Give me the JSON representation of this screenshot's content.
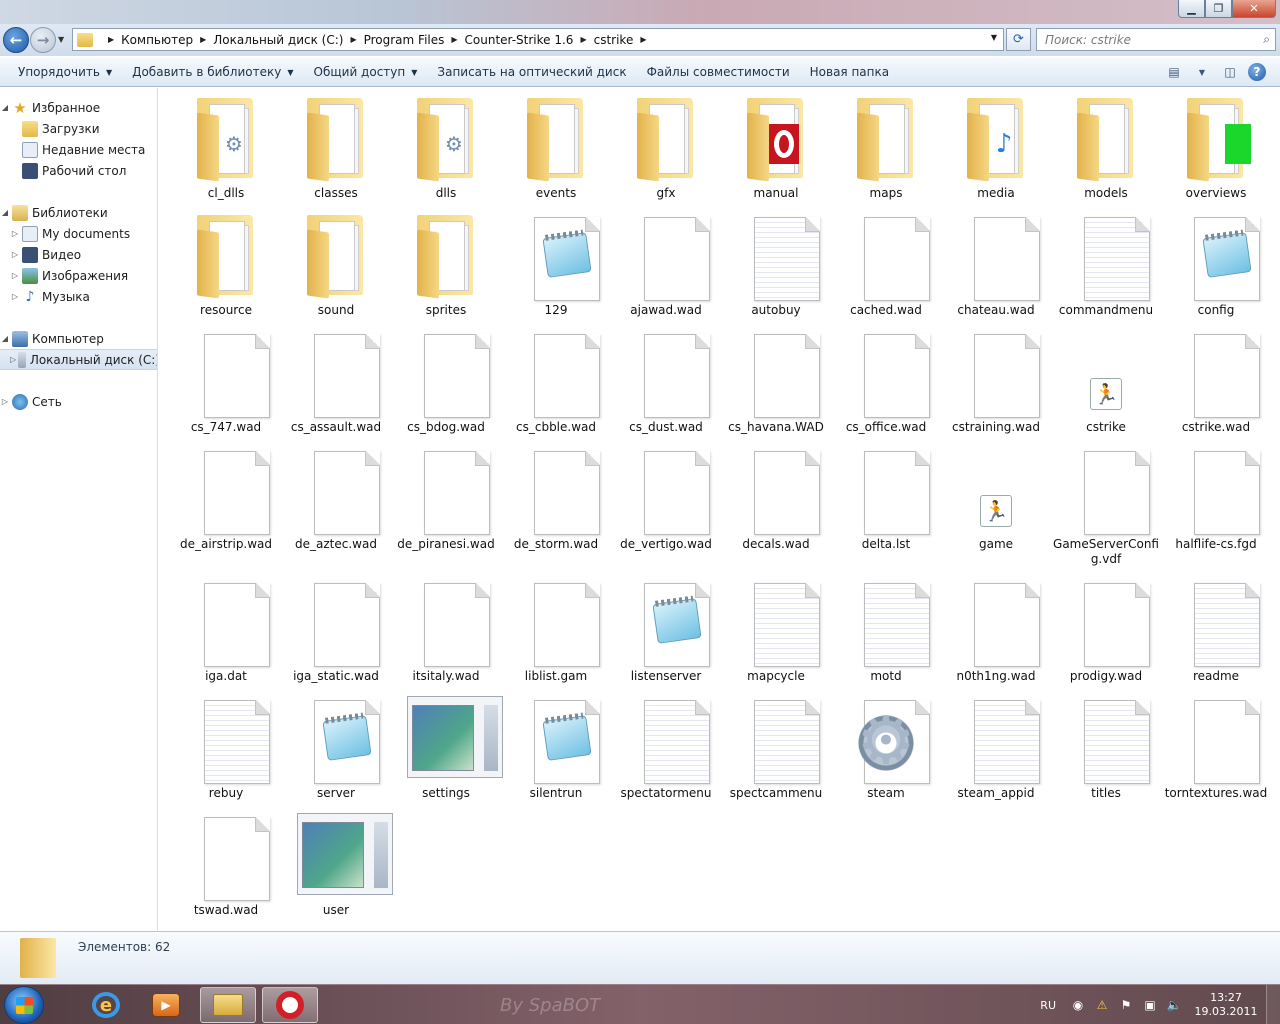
{
  "navigation": {
    "breadcrumbs": [
      "Компьютер",
      "Локальный диск (C:)",
      "Program Files",
      "Counter-Strike 1.6",
      "cstrike"
    ],
    "search_placeholder": "Поиск: cstrike"
  },
  "toolbar": {
    "items": [
      "Упорядочить",
      "Добавить в библиотеку",
      "Общий доступ",
      "Записать на оптический диск",
      "Файлы совместимости",
      "Новая папка"
    ]
  },
  "sidebar": {
    "favorites": "Избранное",
    "fav_items": [
      "Загрузки",
      "Недавние места",
      "Рабочий стол"
    ],
    "libraries": "Библиотеки",
    "lib_items": [
      "My documents",
      "Видео",
      "Изображения",
      "Музыка"
    ],
    "computer": "Компьютер",
    "computer_items": [
      "Локальный диск (C:)"
    ],
    "network": "Сеть"
  },
  "files": [
    {
      "name": "cl_dlls",
      "kind": "folder",
      "emblem": "gear"
    },
    {
      "name": "classes",
      "kind": "folder"
    },
    {
      "name": "dlls",
      "kind": "folder",
      "emblem": "gear"
    },
    {
      "name": "events",
      "kind": "folder"
    },
    {
      "name": "gfx",
      "kind": "folder"
    },
    {
      "name": "manual",
      "kind": "folder",
      "emblem": "opera"
    },
    {
      "name": "maps",
      "kind": "folder"
    },
    {
      "name": "media",
      "kind": "folder",
      "emblem": "mp3"
    },
    {
      "name": "models",
      "kind": "folder"
    },
    {
      "name": "overviews",
      "kind": "folder",
      "emblem": "green"
    },
    {
      "name": "resource",
      "kind": "folder"
    },
    {
      "name": "sound",
      "kind": "folder"
    },
    {
      "name": "sprites",
      "kind": "folder"
    },
    {
      "name": "129",
      "kind": "notepad"
    },
    {
      "name": "ajawad.wad",
      "kind": "blank"
    },
    {
      "name": "autobuy",
      "kind": "text"
    },
    {
      "name": "cached.wad",
      "kind": "blank"
    },
    {
      "name": "chateau.wad",
      "kind": "blank"
    },
    {
      "name": "commandmenu",
      "kind": "text"
    },
    {
      "name": "config",
      "kind": "notepad"
    },
    {
      "name": "cs_747.wad",
      "kind": "blank"
    },
    {
      "name": "cs_assault.wad",
      "kind": "blank"
    },
    {
      "name": "cs_bdog.wad",
      "kind": "blank"
    },
    {
      "name": "cs_cbble.wad",
      "kind": "blank"
    },
    {
      "name": "cs_dust.wad",
      "kind": "blank"
    },
    {
      "name": "cs_havana.WAD",
      "kind": "blank"
    },
    {
      "name": "cs_office.wad",
      "kind": "blank"
    },
    {
      "name": "cstraining.wad",
      "kind": "blank"
    },
    {
      "name": "cstrike",
      "kind": "cs"
    },
    {
      "name": "cstrike.wad",
      "kind": "blank"
    },
    {
      "name": "de_airstrip.wad",
      "kind": "blank"
    },
    {
      "name": "de_aztec.wad",
      "kind": "blank"
    },
    {
      "name": "de_piranesi.wad",
      "kind": "blank"
    },
    {
      "name": "de_storm.wad",
      "kind": "blank"
    },
    {
      "name": "de_vertigo.wad",
      "kind": "blank"
    },
    {
      "name": "decals.wad",
      "kind": "blank"
    },
    {
      "name": "delta.lst",
      "kind": "blank"
    },
    {
      "name": "game",
      "kind": "cs"
    },
    {
      "name": "GameServerConfig.vdf",
      "kind": "blank"
    },
    {
      "name": "halflife-cs.fgd",
      "kind": "blank"
    },
    {
      "name": "iga.dat",
      "kind": "blank"
    },
    {
      "name": "iga_static.wad",
      "kind": "blank"
    },
    {
      "name": "itsitaly.wad",
      "kind": "blank"
    },
    {
      "name": "liblist.gam",
      "kind": "blank"
    },
    {
      "name": "listenserver",
      "kind": "notepad"
    },
    {
      "name": "mapcycle",
      "kind": "text"
    },
    {
      "name": "motd",
      "kind": "text"
    },
    {
      "name": "n0th1ng.wad",
      "kind": "blank"
    },
    {
      "name": "prodigy.wad",
      "kind": "blank"
    },
    {
      "name": "readme",
      "kind": "text"
    },
    {
      "name": "rebuy",
      "kind": "text"
    },
    {
      "name": "server",
      "kind": "notepad"
    },
    {
      "name": "settings",
      "kind": "window"
    },
    {
      "name": "silentrun",
      "kind": "notepad"
    },
    {
      "name": "spectatormenu",
      "kind": "text"
    },
    {
      "name": "spectcammenu",
      "kind": "text"
    },
    {
      "name": "steam",
      "kind": "gear"
    },
    {
      "name": "steam_appid",
      "kind": "text"
    },
    {
      "name": "titles",
      "kind": "text"
    },
    {
      "name": "torntextures.wad",
      "kind": "blank"
    },
    {
      "name": "tswad.wad",
      "kind": "blank"
    },
    {
      "name": "user",
      "kind": "window"
    }
  ],
  "status": {
    "count_text": "Элементов: 62"
  },
  "taskbar": {
    "watermark": "By SpaBOT",
    "lang": "RU",
    "time": "13:27",
    "date": "19.03.2011"
  }
}
